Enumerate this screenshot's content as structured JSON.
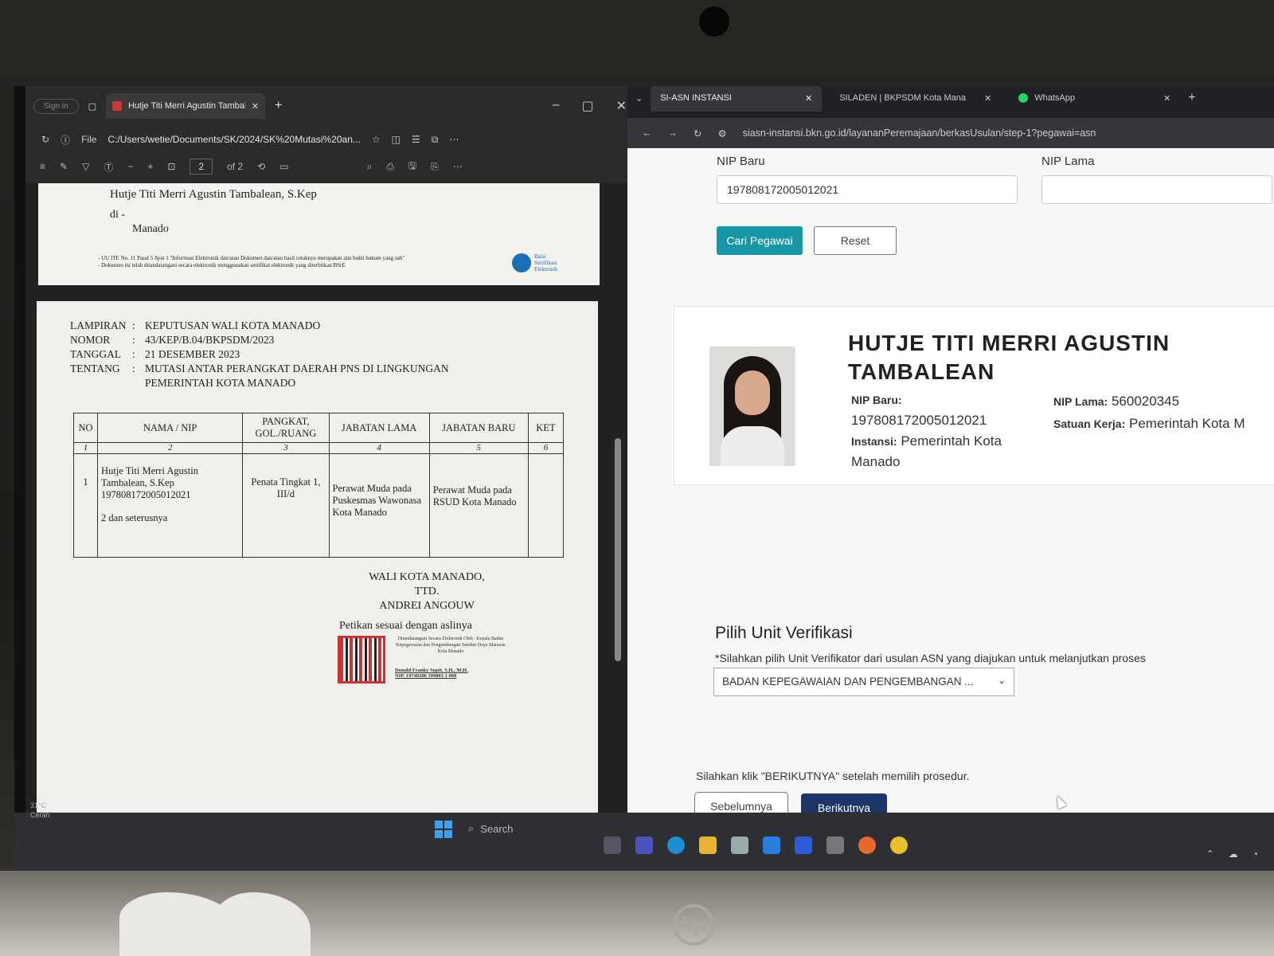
{
  "pdf": {
    "signin": "Sign in",
    "tab_title": "Hutje Titi Merri Agustin Tambalean",
    "file_label": "File",
    "url": "C:/Users/wetie/Documents/SK/2024/SK%20Mutasi%20an...",
    "page_current": "2",
    "page_total": "of 2",
    "page1": {
      "recipient": "Hutje Titi Merri Agustin Tambalean, S.Kep",
      "di": "di -",
      "city": "Manado",
      "legal_1": "- UU ITE No. 11 Pasal 5 Ayat 1 \"Informasi Elektronik dan/atau Dokumen dan/atau hasil cetaknya merupakan alat bukti hukum yang sah\"",
      "legal_2": "- Dokumen ini telah ditandatangani secara elektronik menggunakan sertifikat elektronik yang diterbitkan BSrE",
      "bsre": "Balai Sertifikasi Elektronik"
    },
    "page2": {
      "lampiran_k": "LAMPIRAN",
      "lampiran_v": "KEPUTUSAN WALI KOTA MANADO",
      "nomor_k": "NOMOR",
      "nomor_v": "43/KEP/B.04/BKPSDM/2023",
      "tanggal_k": "TANGGAL",
      "tanggal_v": "21 DESEMBER 2023",
      "tentang_k": "TENTANG",
      "tentang_v": "MUTASI ANTAR PERANGKAT DAERAH PNS DI LINGKUNGAN",
      "tentang_v2": "PEMERINTAH KOTA MANADO",
      "colon": ":",
      "headers": [
        "NO",
        "NAMA / NIP",
        "PANGKAT, GOL./RUANG",
        "JABATAN LAMA",
        "JABATAN BARU",
        "KET"
      ],
      "index": [
        "1",
        "2",
        "3",
        "4",
        "5",
        "6"
      ],
      "row": {
        "no": "1",
        "nama": "Hutje Titi Merri Agustin Tambalean, S.Kep",
        "nip": "197808172005012021",
        "extra": "2 dan seterusnya",
        "pangkat": "Penata Tingkat 1, III/d",
        "jabatan_lama": "Perawat Muda pada Puskesmas Wawonasa Kota Manado",
        "jabatan_baru": "Perawat Muda pada RSUD Kota Manado",
        "ket": ""
      },
      "sig_1": "WALI KOTA MANADO,",
      "sig_2": "TTD.",
      "sig_3": "ANDREI ANGOUW",
      "petikan": "Petikan sesuai dengan aslinya",
      "stamp": "Ditandatangani Secara Elektronik Oleh : Kepala Badan Kepegawaian dan Pengembangan Sumber Daya Manusia Kota Manado",
      "stamp_name": "Donald Franky Supit, S.H., M.H.",
      "stamp_nip": "NIP. 19740206 199803 1 008"
    }
  },
  "browser": {
    "tabs": [
      {
        "label": "SI-ASN INSTANSI"
      },
      {
        "label": "SILADEN | BKPSDM Kota Mana"
      },
      {
        "label": "WhatsApp"
      }
    ],
    "url": "siasn-instansi.bkn.go.id/layananPeremajaan/berkasUsulan/step-1?pegawai=asn",
    "nip_baru_label": "NIP Baru",
    "nip_baru_value": "197808172005012021",
    "nip_lama_label": "NIP Lama",
    "nip_lama_value": "",
    "cari_label": "Cari Pegawai",
    "reset_label": "Reset",
    "profile": {
      "name": "HUTJE TITI MERRI AGUSTIN TAMBALEAN",
      "nip_baru_label": "NIP Baru:",
      "nip_baru": "197808172005012021",
      "instansi_label": "Instansi:",
      "instansi": "Pemerintah Kota Manado",
      "nip_lama_label": "NIP Lama:",
      "nip_lama": "560020345",
      "satuan_label": "Satuan Kerja:",
      "satuan": "Pemerintah Kota M"
    },
    "section_title": "Pilih Unit Verifikasi",
    "hint": "*Silahkan pilih Unit Verifikator dari usulan ASN yang diajukan untuk melanjutkan proses",
    "select_value": "BADAN KEPEGAWAIAN DAN PENGEMBANGAN ...",
    "footer_hint": "Silahkan klik \"BERIKUTNYA\" setelah memilih prosedur.",
    "prev_label": "Sebelumnya",
    "next_label": "Berikutnya"
  },
  "taskbar": {
    "weather_temp": "31°C",
    "weather_desc": "Cerah",
    "search": "Search"
  },
  "colors": {
    "primary_button": "#1797a6",
    "next_button": "#1c3568"
  }
}
